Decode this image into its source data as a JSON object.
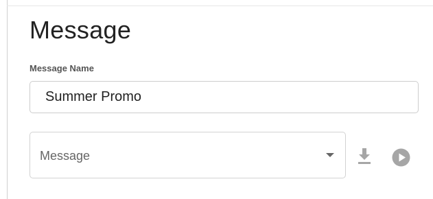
{
  "page": {
    "title": "Message"
  },
  "form": {
    "name_label": "Message Name",
    "name_value": "Summer Promo",
    "message_select": {
      "placeholder": "Message",
      "selected": ""
    }
  },
  "actions": {
    "download_icon": "download-icon",
    "play_icon": "play-icon"
  },
  "colors": {
    "icon_gray": "#a6a6a6",
    "border": "#cccccc",
    "title_text": "#222222"
  }
}
